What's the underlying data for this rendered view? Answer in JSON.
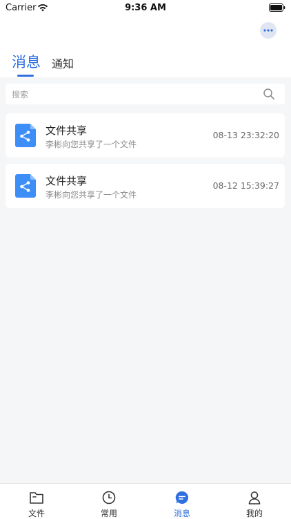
{
  "status_bar": {
    "carrier": "Carrier",
    "time": "9:36 AM"
  },
  "header": {
    "tabs": [
      {
        "label": "消息",
        "active": true
      },
      {
        "label": "通知",
        "active": false
      }
    ],
    "more_icon": "more-icon"
  },
  "search": {
    "placeholder": "搜索",
    "icon": "search-icon"
  },
  "messages": [
    {
      "title": "文件共享",
      "subtitle": "李彬向您共享了一个文件",
      "time": "08-13 23:32:20",
      "icon": "share-file-icon"
    },
    {
      "title": "文件共享",
      "subtitle": "李彬向您共享了一个文件",
      "time": "08-12 15:39:27",
      "icon": "share-file-icon"
    }
  ],
  "tab_bar": {
    "items": [
      {
        "label": "文件",
        "icon": "folder-icon",
        "active": false
      },
      {
        "label": "常用",
        "icon": "clock-icon",
        "active": false
      },
      {
        "label": "消息",
        "icon": "message-icon",
        "active": true
      },
      {
        "label": "我的",
        "icon": "user-icon",
        "active": false
      }
    ]
  },
  "colors": {
    "accent": "#2f6fdf",
    "file_icon": "#3d8ef7",
    "background": "#f5f6f8"
  }
}
